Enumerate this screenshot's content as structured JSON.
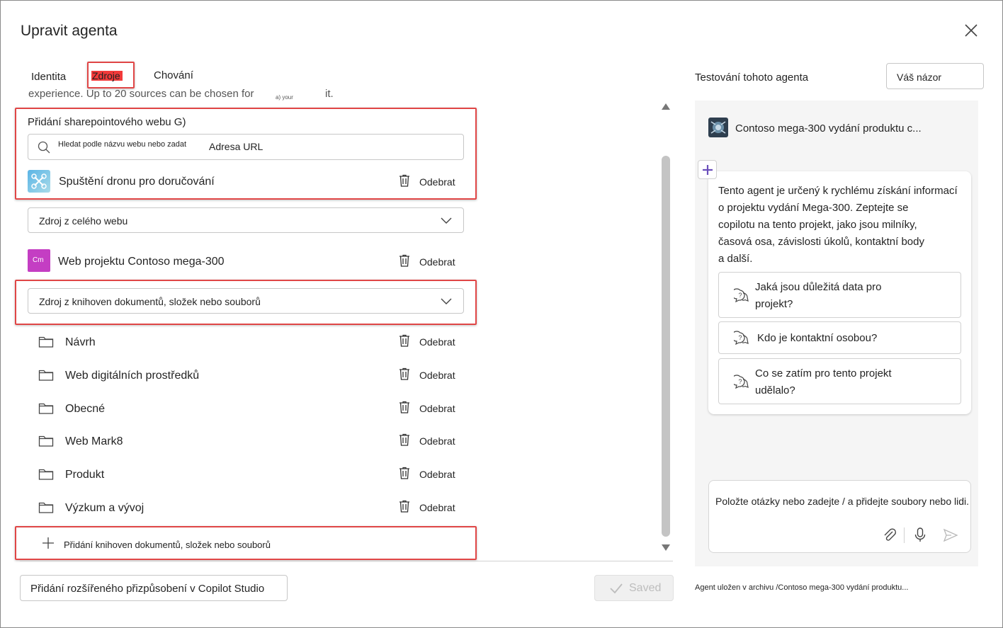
{
  "dialog": {
    "title": "Upravit agenta"
  },
  "tabs": [
    {
      "label": "Identita"
    },
    {
      "label": "Zdroje"
    },
    {
      "label": "Chování"
    }
  ],
  "cut_text": {
    "main": "experience. Up to 20 sources can be chosen for",
    "small": "a) your",
    "end": "it."
  },
  "sharepoint": {
    "label": "Přidání sharepointového webu G)",
    "search_placeholder": "Hledat podle názvu webu nebo zadat",
    "search_value": "Adresa URL"
  },
  "sites": [
    {
      "name": "Spuštění dronu pro doručování",
      "remove": "Odebrat",
      "scope": "Zdroj z celého webu"
    },
    {
      "name": "Web projektu Contoso mega-300",
      "initials": "Cm",
      "remove": "Odebrat",
      "scope": "Zdroj z knihoven dokumentů, složek nebo souborů"
    }
  ],
  "folders": [
    {
      "name": "Návrh",
      "remove": "Odebrat"
    },
    {
      "name": "Web digitálních prostředků",
      "remove": "Odebrat"
    },
    {
      "name": "Obecné",
      "remove": "Odebrat"
    },
    {
      "name": "Web Mark8",
      "remove": "Odebrat"
    },
    {
      "name": "Produkt",
      "remove": "Odebrat"
    },
    {
      "name": "Výzkum a vývoj",
      "remove": "Odebrat"
    }
  ],
  "add_library": {
    "label": "Přidání knihoven dokumentů, složek nebo souborů"
  },
  "footer": {
    "copilot_button": "Přidání rozšířeného přizpůsobení v Copilot Studio",
    "saved_button": "Saved",
    "status": "Agent uložen v archivu /Contoso mega-300 vydání produktu..."
  },
  "test_panel": {
    "title": "Testování tohoto agenta",
    "feedback_button": "Váš názor",
    "agent_name": "Contoso mega-300 vydání produktu c...",
    "description_lines": [
      "Tento agent je určený k rychlému získání informací",
      "o projektu vydání Mega-300. Zeptejte se",
      "copilotu na tento projekt, jako jsou milníky,",
      "časová osa, závislosti úkolů, kontaktní body",
      "a další."
    ],
    "suggestions": [
      {
        "lines": [
          "Jaká jsou důležitá data pro",
          "projekt?"
        ]
      },
      {
        "lines": [
          "Kdo je kontaktní osobou?"
        ]
      },
      {
        "lines": [
          "Co se zatím pro tento projekt",
          "udělalo?"
        ]
      }
    ],
    "input_placeholder": "Položte otázky nebo zadejte / a přidejte soubory nebo lidi."
  },
  "colors": {
    "highlight": "#e04646",
    "accent_purple": "#6b4fbb",
    "site_tile": "#c43ec3"
  }
}
